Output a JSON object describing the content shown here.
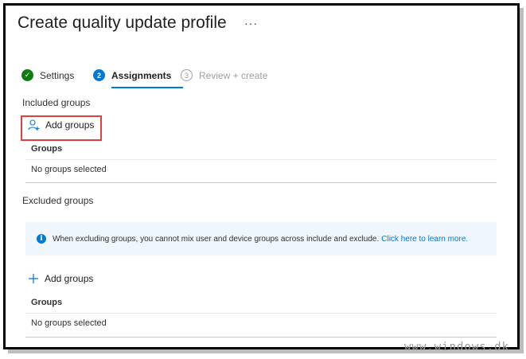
{
  "header": {
    "title": "Create quality update profile",
    "more": "···"
  },
  "steps": [
    {
      "number": "✓",
      "label": "Settings",
      "state": "done"
    },
    {
      "number": "2",
      "label": "Assignments",
      "state": "active"
    },
    {
      "number": "3",
      "label": "Review + create",
      "state": "pending"
    }
  ],
  "included": {
    "section_label": "Included groups",
    "add_label": "Add groups",
    "column_header": "Groups",
    "empty_text": "No groups selected"
  },
  "excluded": {
    "section_label": "Excluded groups",
    "info_text": "When excluding groups, you cannot mix user and device groups across include and exclude.",
    "info_link": "Click here to learn more.",
    "add_label": "Add groups",
    "column_header": "Groups",
    "empty_text": "No groups selected"
  },
  "watermark": "www.windows.dk",
  "colors": {
    "accent": "#0078d4",
    "success": "#107c10",
    "highlight": "#e0403f",
    "info_bg": "#eff6fc"
  }
}
